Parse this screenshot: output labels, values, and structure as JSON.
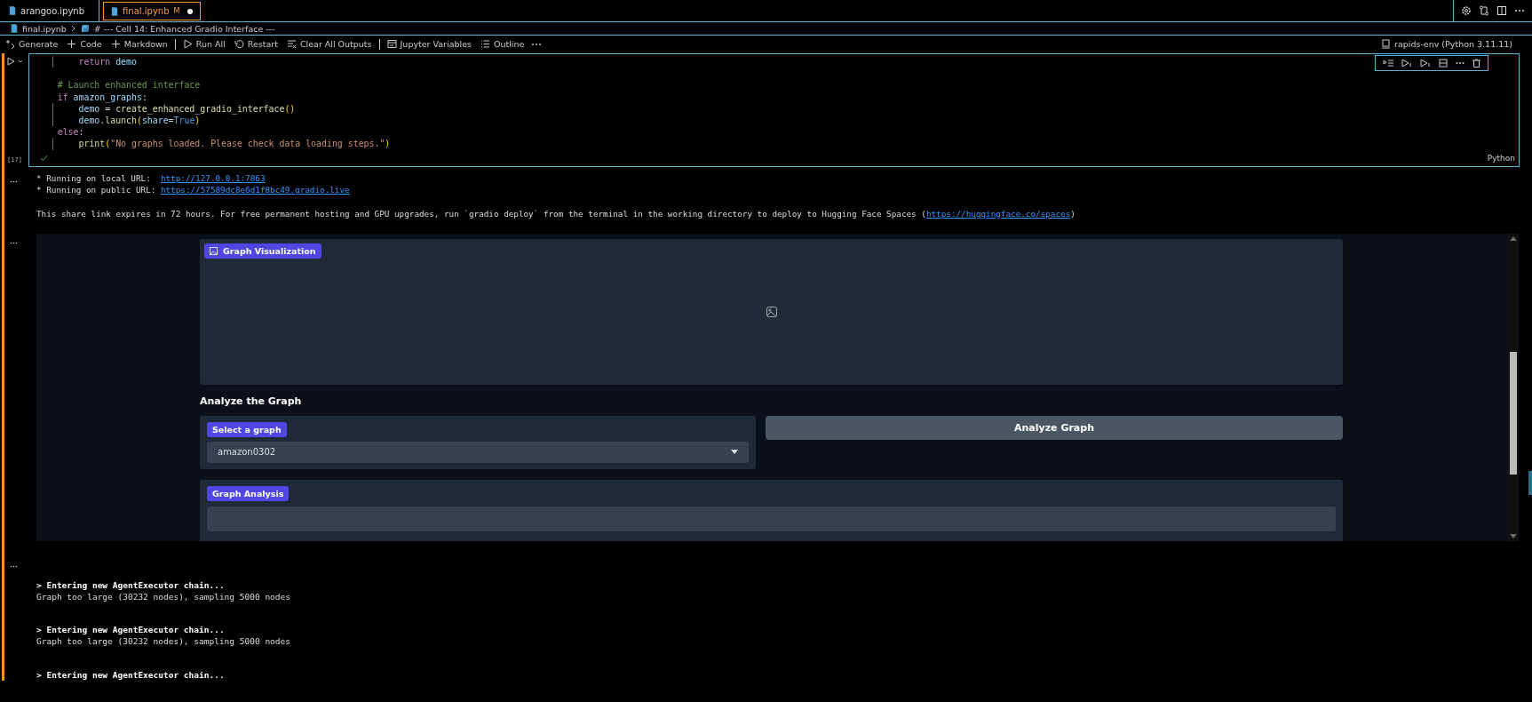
{
  "tabs": [
    {
      "label": "arangoo.ipynb",
      "selected": false,
      "unsaved": false
    },
    {
      "label": "final.ipynb",
      "selected": true,
      "badge": "M",
      "unsaved": true
    }
  ],
  "breadcrumb": [
    "final.ipynb",
    "# --- Cell 14: Enhanced Gradio Interface ---"
  ],
  "toolbar": [
    "Generate",
    "Code",
    "Markdown",
    "Run All",
    "Restart",
    "Clear All Outputs",
    "Jupyter Variables",
    "Outline"
  ],
  "kernel": "rapids-env (Python 3.11.11)",
  "cell": {
    "execution_count": "[17]",
    "succeeded": true,
    "language": "Python",
    "code": [
      {
        "kind": "code",
        "tokens": [
          {
            "kind": "keyword",
            "text": "        return "
          },
          {
            "kind": "var",
            "text": "demo"
          }
        ]
      },
      {
        "kind": "blank"
      },
      {
        "kind": "code",
        "tokens": [
          {
            "kind": "comment",
            "text": "    # Launch enhanced interface"
          }
        ]
      },
      {
        "kind": "code",
        "tokens": [
          {
            "kind": "keyword",
            "text": "    if "
          },
          {
            "kind": "var",
            "text": "amazon_graphs"
          },
          {
            "kind": "plain",
            "text": ":"
          }
        ]
      },
      {
        "kind": "code",
        "tokens": [
          {
            "kind": "var",
            "text": "        demo"
          },
          {
            "kind": "plain",
            "text": " = "
          },
          {
            "kind": "func",
            "text": "create_enhanced_gradio_interface"
          },
          {
            "kind": "paren",
            "text": "()"
          }
        ]
      },
      {
        "kind": "code",
        "tokens": [
          {
            "kind": "var",
            "text": "        demo"
          },
          {
            "kind": "plain",
            "text": "."
          },
          {
            "kind": "func",
            "text": "launch"
          },
          {
            "kind": "paren",
            "text": "("
          },
          {
            "kind": "var",
            "text": "share"
          },
          {
            "kind": "plain",
            "text": "="
          },
          {
            "kind": "const",
            "text": "True"
          },
          {
            "kind": "paren",
            "text": ")"
          }
        ]
      },
      {
        "kind": "code",
        "tokens": [
          {
            "kind": "keyword",
            "text": "    else"
          },
          {
            "kind": "plain",
            "text": ":"
          }
        ]
      },
      {
        "kind": "code",
        "tokens": [
          {
            "kind": "func",
            "text": "        print"
          },
          {
            "kind": "paren",
            "text": "("
          },
          {
            "kind": "string",
            "text": "\"No graphs loaded. Please check data loading steps.\""
          },
          {
            "kind": "paren",
            "text": ")"
          }
        ]
      }
    ]
  },
  "output": [
    {
      "kind": "line",
      "tokens": [
        {
          "kind": "text",
          "text": "* Running on local URL:  "
        },
        {
          "kind": "link",
          "text": "http://127.0.0.1:7863"
        }
      ]
    },
    {
      "kind": "line",
      "tokens": [
        {
          "kind": "text",
          "text": "* Running on public URL: "
        },
        {
          "kind": "link",
          "text": "https://57589dc8e6d1f8bc49.gradio.live"
        }
      ]
    },
    {
      "kind": "blank"
    },
    {
      "kind": "line",
      "tokens": [
        {
          "kind": "text",
          "text": "This share link expires in 72 hours. For free permanent hosting and GPU upgrades, run `gradio deploy` from the terminal in the working directory to deploy to Hugging Face Spaces ("
        },
        {
          "kind": "link",
          "text": "https://huggingface.co/spaces"
        },
        {
          "kind": "text",
          "text": ")"
        }
      ]
    }
  ],
  "gradio": {
    "image_label": "Graph Visualization",
    "heading": "Analyze the Graph",
    "dropdown_label": "Select a graph",
    "dropdown_value": "amazon0302",
    "button": "Analyze Graph",
    "analysis_label": "Graph Analysis"
  },
  "logs": [
    {
      "kind": "chain",
      "text": "> Entering new AgentExecutor chain..."
    },
    {
      "kind": "plain",
      "text": "Graph too large (30232 nodes), sampling 5000 nodes"
    },
    {
      "kind": "gap"
    },
    {
      "kind": "chain",
      "text": "> Entering new AgentExecutor chain..."
    },
    {
      "kind": "plain",
      "text": "Graph too large (30232 nodes), sampling 5000 nodes"
    },
    {
      "kind": "gap"
    },
    {
      "kind": "chain",
      "text": "> Entering new AgentExecutor chain..."
    }
  ]
}
